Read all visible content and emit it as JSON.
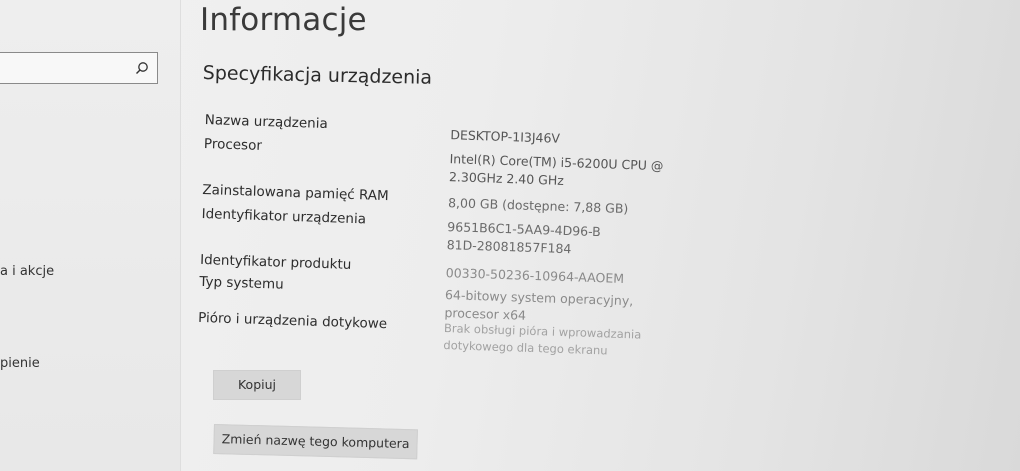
{
  "sidebar": {
    "search": {
      "value": "",
      "placeholder": ""
    },
    "items": [
      {
        "label": "a i akcje"
      },
      {
        "label": "pienie"
      }
    ]
  },
  "page": {
    "title": "Informacje",
    "section_title": "Specyfikacja urządzenia"
  },
  "specs": [
    {
      "label": "Nazwa urządzenia",
      "value": "DESKTOP-1I3J46V"
    },
    {
      "label": "Procesor",
      "value": "Intel(R) Core(TM) i5-6200U CPU @ 2.30GHz   2.40 GHz"
    },
    {
      "label": "Zainstalowana pamięć RAM",
      "value": "8,00 GB (dostępne: 7,88 GB)"
    },
    {
      "label": "Identyfikator urządzenia",
      "value": "9651B6C1-5AA9-4D96-B81D-28081857F184"
    },
    {
      "label": "Identyfikator produktu",
      "value": "00330-50236-10964-AAOEM"
    },
    {
      "label": "Typ systemu",
      "value": "64-bitowy system operacyjny, procesor x64"
    },
    {
      "label": "Pióro i urządzenia dotykowe",
      "value": "Brak obsługi pióra i wprowadzania dotykowego dla tego ekranu"
    }
  ],
  "buttons": {
    "copy_label": "Kopiuj",
    "rename_label": "Zmień nazwę tego komputera"
  }
}
